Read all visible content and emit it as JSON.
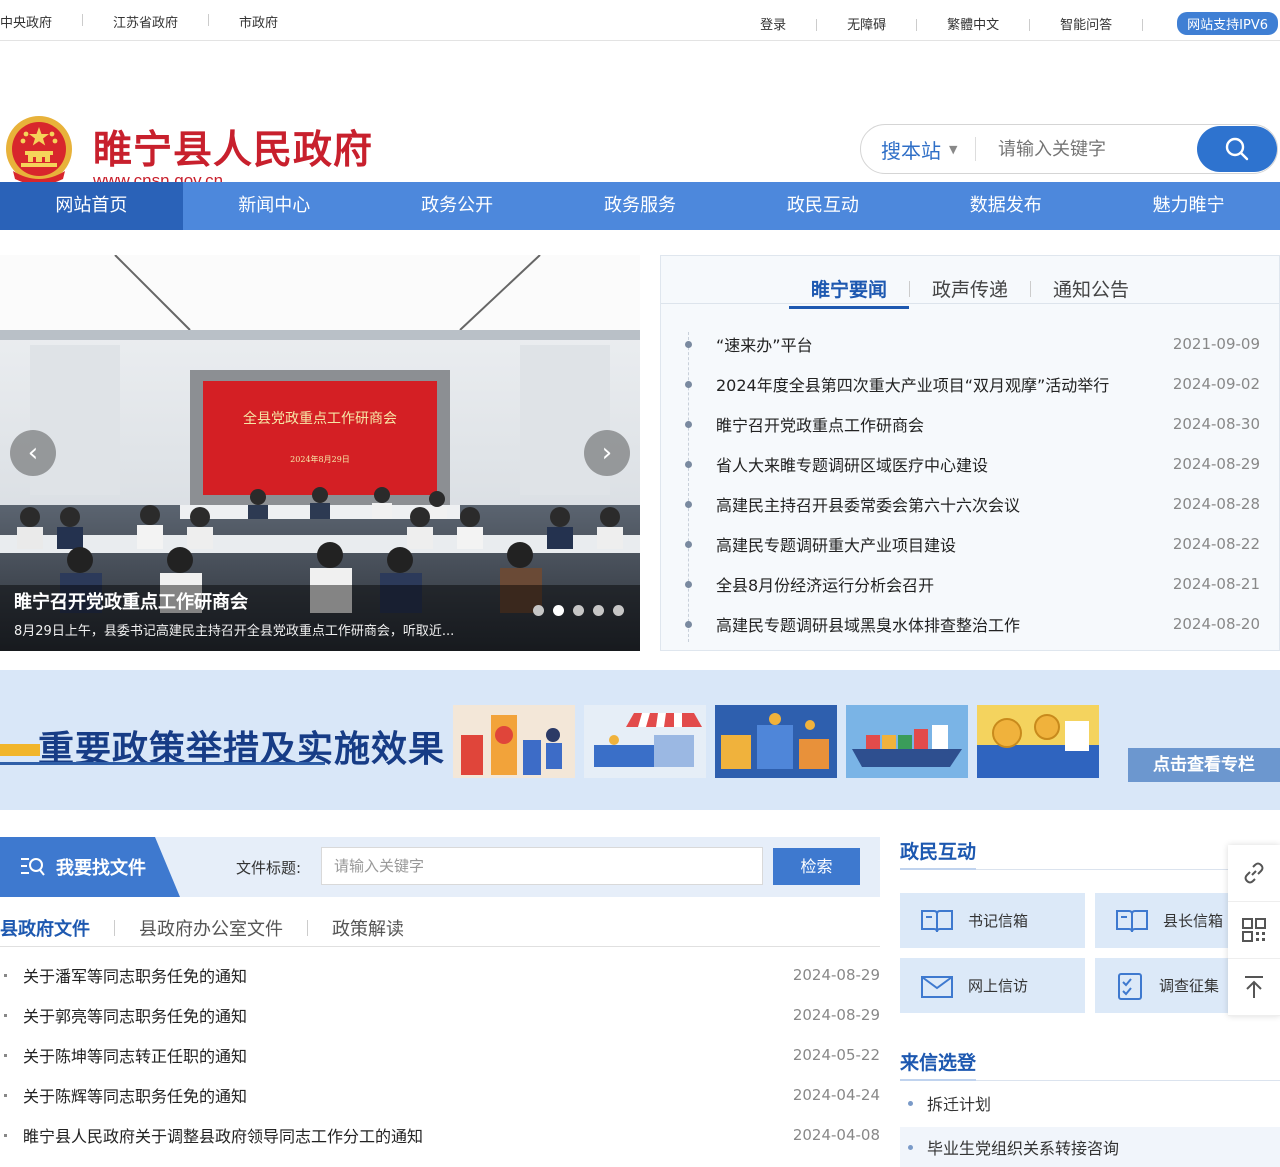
{
  "topbar": {
    "left_links": [
      "中央政府",
      "江苏省政府",
      "市政府"
    ],
    "right_links": [
      "登录",
      "无障碍",
      "繁體中文",
      "智能问答"
    ],
    "ipv6": "网站支持IPV6"
  },
  "header": {
    "title": "睢宁县人民政府",
    "url": "www.cnsn.gov.cn",
    "search_scope": "搜本站",
    "search_placeholder": "请输入关键字"
  },
  "nav": [
    "网站首页",
    "新闻中心",
    "政务公开",
    "政务服务",
    "政民互动",
    "数据发布",
    "魅力睢宁"
  ],
  "carousel": {
    "title": "睢宁召开党政重点工作研商会",
    "desc": "8月29日上午，县委书记高建民主持召开全县党政重点工作研商会，听取近...",
    "screen_text": "全县党政重点工作研商会",
    "screen_date": "2024年8月29日",
    "slide_count": 5,
    "active_slide": 2
  },
  "news": {
    "tabs": [
      "睢宁要闻",
      "政声传递",
      "通知公告"
    ],
    "items": [
      {
        "title": "“速来办”平台",
        "date": "2021-09-09"
      },
      {
        "title": "2024年度全县第四次重大产业项目“双月观摩”活动举行",
        "date": "2024-09-02"
      },
      {
        "title": "睢宁召开党政重点工作研商会",
        "date": "2024-08-30"
      },
      {
        "title": "省人大来睢专题调研区域医疗中心建设",
        "date": "2024-08-29"
      },
      {
        "title": "高建民主持召开县委常委会第六十六次会议",
        "date": "2024-08-28"
      },
      {
        "title": "高建民专题调研重大产业项目建设",
        "date": "2024-08-22"
      },
      {
        "title": "全县8月份经济运行分析会召开",
        "date": "2024-08-21"
      },
      {
        "title": "高建民专题调研县域黑臭水体排查整治工作",
        "date": "2024-08-20"
      }
    ]
  },
  "banner": {
    "title": "重要政策举措及实施效果",
    "more": "点击查看专栏"
  },
  "docs": {
    "find_label": "我要找文件",
    "field_label": "文件标题:",
    "placeholder": "请输入关键字",
    "button": "检索",
    "tabs": [
      "县政府文件",
      "县政府办公室文件",
      "政策解读"
    ],
    "items": [
      {
        "title": "关于潘军等同志职务任免的通知",
        "date": "2024-08-29"
      },
      {
        "title": "关于郭亮等同志职务任免的通知",
        "date": "2024-08-29"
      },
      {
        "title": "关于陈坤等同志转正任职的通知",
        "date": "2024-05-22"
      },
      {
        "title": "关于陈辉等同志职务任免的通知",
        "date": "2024-04-24"
      },
      {
        "title": "睢宁县人民政府关于调整县政府领导同志工作分工的通知",
        "date": "2024-04-08"
      }
    ]
  },
  "interaction": {
    "title": "政民互动",
    "boxes": [
      "书记信箱",
      "县长信箱",
      "网上信访",
      "调查征集"
    ],
    "letters_title": "来信选登",
    "letters": [
      "拆迁计划",
      "毕业生党组织关系转接咨询"
    ]
  },
  "colors": {
    "nav": "#4d88dc",
    "nav_active": "#2a62b8",
    "brand_red": "#c8202d",
    "accent": "#1d58b0"
  }
}
